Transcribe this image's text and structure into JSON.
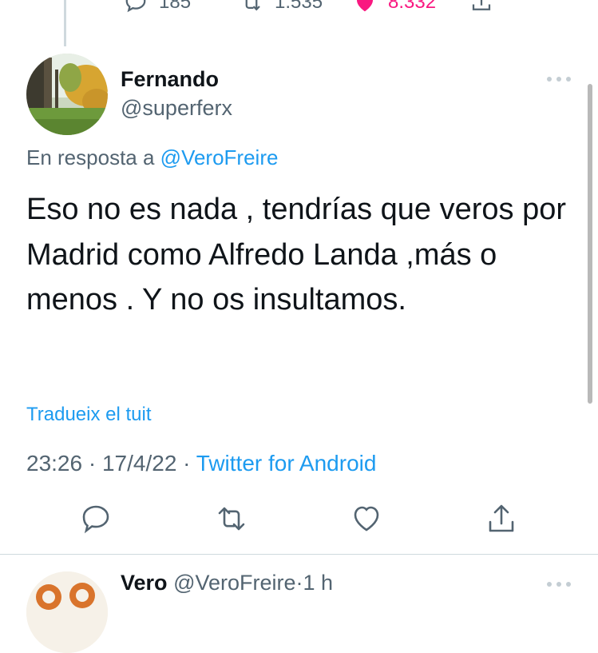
{
  "previous_tweet": {
    "reply_count": "185",
    "retweet_count": "1.535",
    "like_count": "8.332"
  },
  "tweet": {
    "author_name": "Fernando",
    "author_handle": "@superferx",
    "reply_to_prefix": "En resposta a",
    "reply_to_mention": "@VeroFreire",
    "text": "Eso no es nada , tendrías que veros por Madrid como Alfredo Landa ,más o menos . Y no os insultamos.",
    "translate_label": "Tradueix el tuit",
    "time": "23:26",
    "date": "17/4/22",
    "separator": "·",
    "source": "Twitter for Android"
  },
  "next_tweet": {
    "author_name": "Vero",
    "author_handle": "@VeroFreire",
    "separator": "·",
    "age": "1 h"
  },
  "colors": {
    "accent": "#1d9bf0",
    "secondary_text": "#536471",
    "like_pink": "#f91880",
    "divider": "#cfd9de"
  },
  "icons": {
    "reply": "reply-icon",
    "retweet": "retweet-icon",
    "like": "heart-icon",
    "share": "share-icon",
    "more": "more-icon"
  }
}
